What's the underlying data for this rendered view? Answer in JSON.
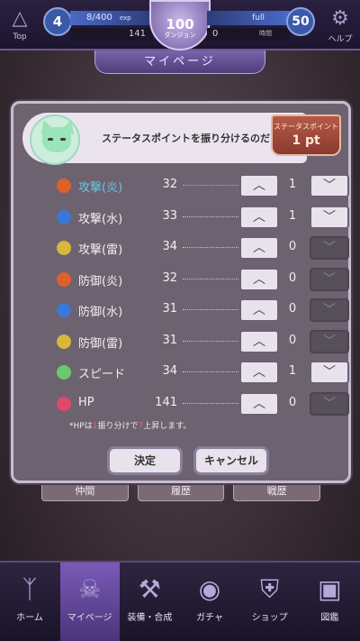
{
  "top": {
    "left_label": "Top",
    "right_label": "ヘルプ",
    "level": "4",
    "exp_text": "8/400",
    "exp_unit": "exp",
    "money": "141",
    "medal_value": "100",
    "medal_label": "ダンジョン",
    "full_text": "full",
    "stamina_value": "0",
    "stamina_label": "時間",
    "stamina_max": "50"
  },
  "page_title": "マイページ",
  "panel": {
    "message": "ステータスポイントを振り分けるのだ",
    "points_label": "ステータスポイント",
    "points_value": "1 pt",
    "rows": [
      {
        "name": "攻撃(炎)",
        "value": "32",
        "alloc": "1",
        "color": "#e0602a",
        "active": true
      },
      {
        "name": "攻撃(水)",
        "value": "33",
        "alloc": "1",
        "color": "#3a78d8",
        "active": false
      },
      {
        "name": "攻撃(雷)",
        "value": "34",
        "alloc": "0",
        "color": "#d8b83a",
        "active": false
      },
      {
        "name": "防御(炎)",
        "value": "32",
        "alloc": "0",
        "color": "#e0602a",
        "active": false
      },
      {
        "name": "防御(水)",
        "value": "31",
        "alloc": "0",
        "color": "#3a78d8",
        "active": false
      },
      {
        "name": "防御(雷)",
        "value": "31",
        "alloc": "0",
        "color": "#d8b83a",
        "active": false
      },
      {
        "name": "スピード",
        "value": "34",
        "alloc": "1",
        "color": "#6ac870",
        "active": false
      },
      {
        "name": "HP",
        "value": "141",
        "alloc": "0",
        "color": "#e04a6a",
        "active": false
      }
    ],
    "note_pre": "*HPは",
    "note_num1": "1",
    "note_mid": "振り分けで",
    "note_num2": "7",
    "note_post": "上昇します。",
    "confirm_label": "決定",
    "cancel_label": "キャンセル",
    "up_glyph": "︿",
    "down_glyph": "﹀"
  },
  "bg_tabs": [
    "仲間",
    "履歴",
    "戦歴"
  ],
  "nav": [
    {
      "label": "ホーム",
      "icon": "ᛉ"
    },
    {
      "label": "マイページ",
      "icon": "☠"
    },
    {
      "label": "装備・合成",
      "icon": "⚒"
    },
    {
      "label": "ガチャ",
      "icon": "◉"
    },
    {
      "label": "ショップ",
      "icon": "⛨"
    },
    {
      "label": "図鑑",
      "icon": "▣"
    }
  ]
}
